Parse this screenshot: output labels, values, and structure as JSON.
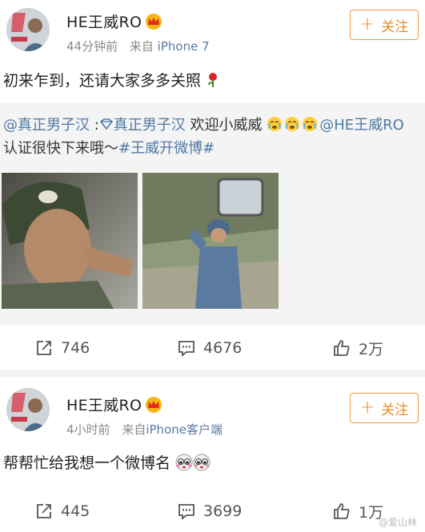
{
  "posts": [
    {
      "user": "HE王威RO",
      "time": "44分钟前",
      "source_prefix": "来自",
      "source": "iPhone 7",
      "follow_label": "关注",
      "text": "初来乍到，还请大家多多关照",
      "repost": {
        "mention1": "@真正男子汉",
        "sep": " :",
        "mention2": "真正男子汉",
        "text1": " 欢迎小威威",
        "mention3": "@HE王威RO",
        "text2": " 认证很快下来哦～",
        "topic": "#王威开微博#"
      },
      "stats": {
        "reposts": "746",
        "comments": "4676",
        "likes": "2万"
      }
    },
    {
      "user": "HE王威RO",
      "time": "4小时前",
      "source_prefix": "来自",
      "source": "iPhone客户端",
      "follow_label": "关注",
      "text": "帮帮忙给我想一个微博名",
      "stats": {
        "reposts": "445",
        "comments": "3699",
        "likes": "1万"
      }
    }
  ],
  "watermark": "@爱山林",
  "colors": {
    "link": "#4f79a6",
    "follow": "#ee8a22",
    "meta": "#8a8a8a"
  }
}
